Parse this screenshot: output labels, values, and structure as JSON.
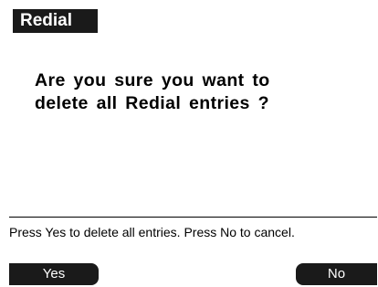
{
  "header": {
    "title": "Redial"
  },
  "dialog": {
    "message_line1": "Are you sure you want to",
    "message_line2": "delete all Redial entries ?"
  },
  "help": {
    "text": "Press Yes to delete all entries. Press No to cancel."
  },
  "softkeys": {
    "left_label": "Yes",
    "right_label": "No"
  },
  "colors": {
    "background": "#ffffff",
    "bar": "#1a1a1a",
    "text": "#000000",
    "bar_text": "#ffffff"
  }
}
